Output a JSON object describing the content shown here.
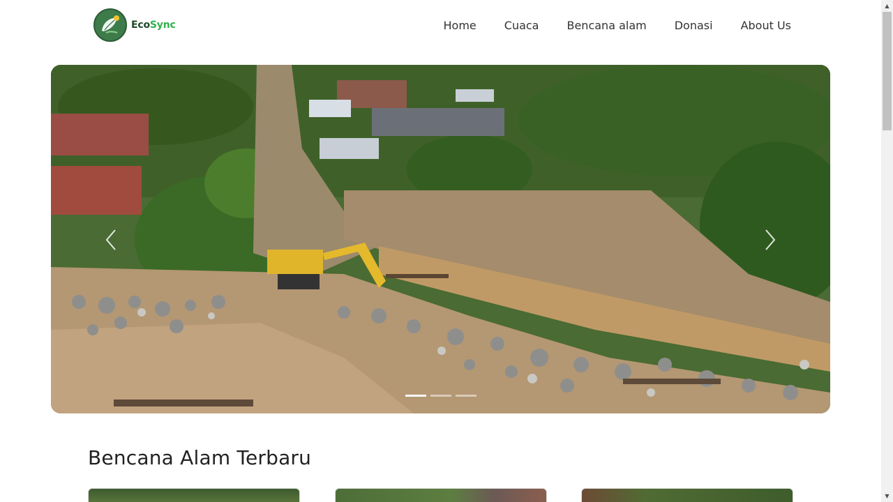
{
  "brand": {
    "part1": "Eco",
    "part2": "Sync"
  },
  "nav": {
    "items": [
      {
        "label": "Home"
      },
      {
        "label": "Cuaca"
      },
      {
        "label": "Bencana alam"
      },
      {
        "label": "Donasi"
      },
      {
        "label": "About Us"
      }
    ]
  },
  "carousel": {
    "slide_count": 3,
    "active_slide": 1,
    "prev_icon": "chevron-left-icon",
    "next_icon": "chevron-right-icon"
  },
  "section": {
    "title": "Bencana Alam Terbaru"
  },
  "colors": {
    "brand_dark": "#1f4a2a",
    "brand_green": "#30b04a"
  }
}
